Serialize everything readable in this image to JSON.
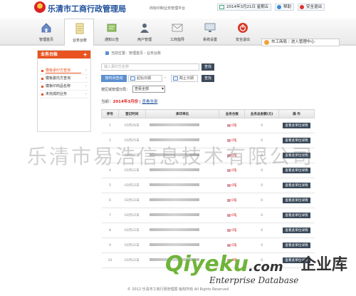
{
  "header": {
    "title": "乐清市工商行政管理局",
    "subtitle": "商标印制业务管理平台",
    "date": "2014年3月21日 星期五",
    "help_label": "帮助",
    "logout_label": "安全退出",
    "colors": {
      "brand_blue": "#1d4f9a",
      "accent_orange": "#e8531f",
      "dark_button": "#3a4a5a"
    }
  },
  "nav": {
    "items": [
      {
        "label": "管理首页",
        "icon": "home-icon"
      },
      {
        "label": "业务台账",
        "icon": "ledger-icon"
      },
      {
        "label": "通知公告",
        "icon": "notice-icon"
      },
      {
        "label": "用户管理",
        "icon": "user-icon"
      },
      {
        "label": "工商指导",
        "icon": "guide-icon"
      },
      {
        "label": "系统设置",
        "icon": "monitor-icon"
      },
      {
        "label": "安全退出",
        "icon": "power-icon"
      }
    ],
    "active_index": 1
  },
  "user": {
    "org": "市工商局",
    "enter": "进入管理中心"
  },
  "sidebar": {
    "title": "业务台账",
    "items": [
      {
        "label": "模板承印方查询"
      },
      {
        "label": "模板委托方查询"
      },
      {
        "label": "模板印商品名称"
      },
      {
        "label": "未完成的业务"
      }
    ],
    "active_index": 0
  },
  "breadcrumb": "当前位置：管理首页 - 业务台账",
  "search": {
    "placeholder": "输入承印方名称",
    "button": "查找",
    "date_type": "按时间查询",
    "start_label": "起始日期",
    "end_label": "截止日期",
    "button2": "查找"
  },
  "sort": {
    "label": "按区域管理分局：",
    "selected": "查看全部"
  },
  "filter": {
    "prefix": "当前：",
    "value": "2014年3月份",
    "sep": "| ",
    "link": "查看全部"
  },
  "table": {
    "headers": [
      "序号",
      "登记时间",
      "承印单位",
      "业务台账",
      "业务总金额(元)",
      "操 作"
    ],
    "detail_label": "查看此单位详情",
    "rows": [
      {
        "no": "1",
        "date": "03月26日",
        "biz": "0笔",
        "amount": "0"
      },
      {
        "no": "2",
        "date": "03月25日",
        "biz": "0笔",
        "amount": "0"
      },
      {
        "no": "3",
        "date": "03月22日",
        "biz": "0笔",
        "amount": "0"
      },
      {
        "no": "4",
        "date": "03月22日",
        "biz": "0笔",
        "amount": "0"
      },
      {
        "no": "5",
        "date": "03月22日",
        "biz": "0笔",
        "amount": "0"
      },
      {
        "no": "6",
        "date": "03月22日",
        "biz": "0笔",
        "amount": "0"
      },
      {
        "no": "7",
        "date": "03月22日",
        "biz": "0笔",
        "amount": "0"
      },
      {
        "no": "8",
        "date": "03月22日",
        "biz": "0笔",
        "amount": "0"
      },
      {
        "no": "9",
        "date": "03月22日",
        "biz": "0笔",
        "amount": "0"
      },
      {
        "no": "10",
        "date": "03月22日",
        "biz": "0笔",
        "amount": "0"
      }
    ]
  },
  "watermark": {
    "text": "乐清市易浩信息技术有限公司",
    "logo_q": "Qiyeku",
    "logo_tld": ".com",
    "logo_cn": "企业库",
    "logo_en": "Enterprise Database"
  },
  "footer": "© 2012 乐清市工商行政管理局 版权所有 All Rights Reserved"
}
